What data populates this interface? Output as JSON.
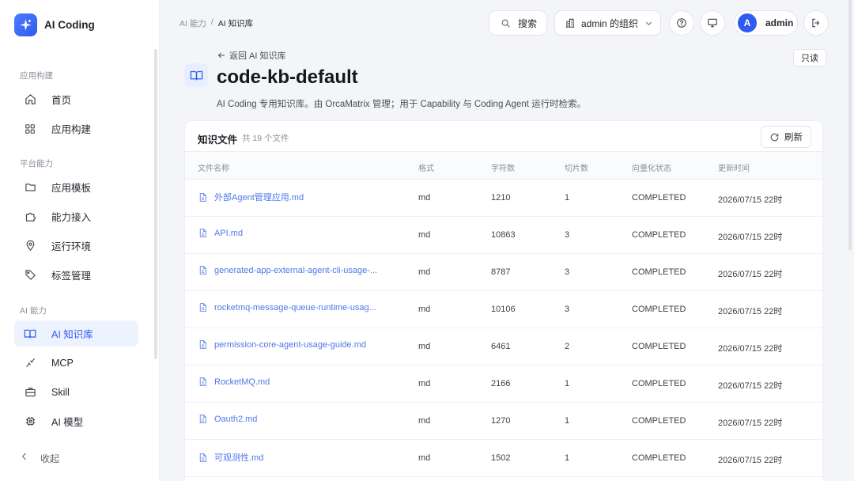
{
  "app": {
    "name": "AI Coding"
  },
  "sidebar": {
    "sections": [
      {
        "label": "应用构建"
      },
      {
        "label": "平台能力"
      },
      {
        "label": "AI 能力"
      }
    ],
    "items": [
      {
        "label": "首页",
        "icon": "home-icon"
      },
      {
        "label": "应用构建",
        "icon": "grid-icon"
      },
      {
        "label": "应用模板",
        "icon": "folder-icon"
      },
      {
        "label": "能力接入",
        "icon": "puzzle-icon"
      },
      {
        "label": "运行环境",
        "icon": "location-pin-icon"
      },
      {
        "label": "标签管理",
        "icon": "tag-icon"
      },
      {
        "label": "AI 知识库",
        "icon": "book-icon",
        "active": true
      },
      {
        "label": "MCP",
        "icon": "plug-icon"
      },
      {
        "label": "Skill",
        "icon": "briefcase-icon"
      },
      {
        "label": "AI 模型",
        "icon": "chip-icon"
      }
    ],
    "collapse_label": "收起"
  },
  "header": {
    "breadcrumb": {
      "parent": "AI 能力",
      "separator": "/",
      "current": "AI 知识库"
    },
    "search_label": "搜索",
    "org_label": "admin 的组织",
    "user": {
      "initial": "A",
      "name": "admin"
    }
  },
  "kb": {
    "back_label": "返回 AI 知识库",
    "title": "code-kb-default",
    "description": "AI Coding 专用知识库。由 OrcaMatrix 管理；用于 Capability 与 Coding Agent 运行时检索。",
    "readonly_label": "只读"
  },
  "files": {
    "title": "知识文件",
    "count_label": "共 19 个文件",
    "refresh_label": "刷新",
    "columns": [
      "文件名称",
      "格式",
      "字符数",
      "切片数",
      "向量化状态",
      "更新时间"
    ],
    "rows": [
      {
        "name": "外部Agent管理应用.md",
        "format": "md",
        "chars": "1210",
        "chunks": "1",
        "status": "COMPLETED",
        "updated": "2026/07/15 22时"
      },
      {
        "name": "API.md",
        "format": "md",
        "chars": "10863",
        "chunks": "3",
        "status": "COMPLETED",
        "updated": "2026/07/15 22时"
      },
      {
        "name": "generated-app-external-agent-cli-usage-...",
        "format": "md",
        "chars": "8787",
        "chunks": "3",
        "status": "COMPLETED",
        "updated": "2026/07/15 22时"
      },
      {
        "name": "rocketmq-message-queue-runtime-usag...",
        "format": "md",
        "chars": "10106",
        "chunks": "3",
        "status": "COMPLETED",
        "updated": "2026/07/15 22时"
      },
      {
        "name": "permission-core-agent-usage-guide.md",
        "format": "md",
        "chars": "6461",
        "chunks": "2",
        "status": "COMPLETED",
        "updated": "2026/07/15 22时"
      },
      {
        "name": "RocketMQ.md",
        "format": "md",
        "chars": "2166",
        "chunks": "1",
        "status": "COMPLETED",
        "updated": "2026/07/15 22时"
      },
      {
        "name": "Oauth2.md",
        "format": "md",
        "chars": "1270",
        "chunks": "1",
        "status": "COMPLETED",
        "updated": "2026/07/15 22时"
      },
      {
        "name": "可观测性.md",
        "format": "md",
        "chars": "1502",
        "chunks": "1",
        "status": "COMPLETED",
        "updated": "2026/07/15 22时"
      }
    ]
  },
  "colors": {
    "accent": "#2f5cf0",
    "link": "#4f78e8",
    "active_bg": "#edf2ff"
  }
}
